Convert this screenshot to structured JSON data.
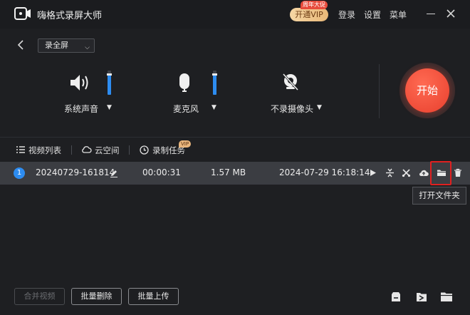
{
  "app": {
    "title": "嗨格式录屏大师"
  },
  "header": {
    "vip_button": "开通VIP",
    "vip_promo": "周年大促",
    "links": [
      "登录",
      "设置",
      "菜单"
    ]
  },
  "controls": {
    "mode_select": "录全屏",
    "sources": [
      {
        "label": "系统声音",
        "icon": "speaker-icon",
        "level": 0.85
      },
      {
        "label": "麦克风",
        "icon": "microphone-icon",
        "level": 0.85
      },
      {
        "label": "不录摄像头",
        "icon": "camera-off-icon"
      }
    ],
    "start_button": "开始"
  },
  "tabs": [
    {
      "label": "视频列表",
      "icon": "list-icon"
    },
    {
      "label": "云空间",
      "icon": "cloud-icon"
    },
    {
      "label": "录制任务",
      "icon": "clock-icon",
      "badge": "VIP"
    }
  ],
  "recordings": [
    {
      "index": "1",
      "name": "20240729-161814",
      "duration": "00:00:31",
      "size": "1.57 MB",
      "date": "2024-07-29 16:18:14"
    }
  ],
  "row_actions": [
    "play-icon",
    "compress-icon",
    "cut-icon",
    "upload-cloud-icon",
    "open-folder-icon",
    "delete-icon"
  ],
  "tooltip": "打开文件夹",
  "footer": {
    "merge_button": "合并视频",
    "batch_delete_button": "批量删除",
    "batch_upload_button": "批量上传",
    "icons": [
      "import-icon",
      "export-icon",
      "folder-icon"
    ]
  },
  "colors": {
    "accent": "#2d8cf0",
    "start": "#e8402e",
    "highlight": "#e02020",
    "vip": "#e9b878"
  }
}
